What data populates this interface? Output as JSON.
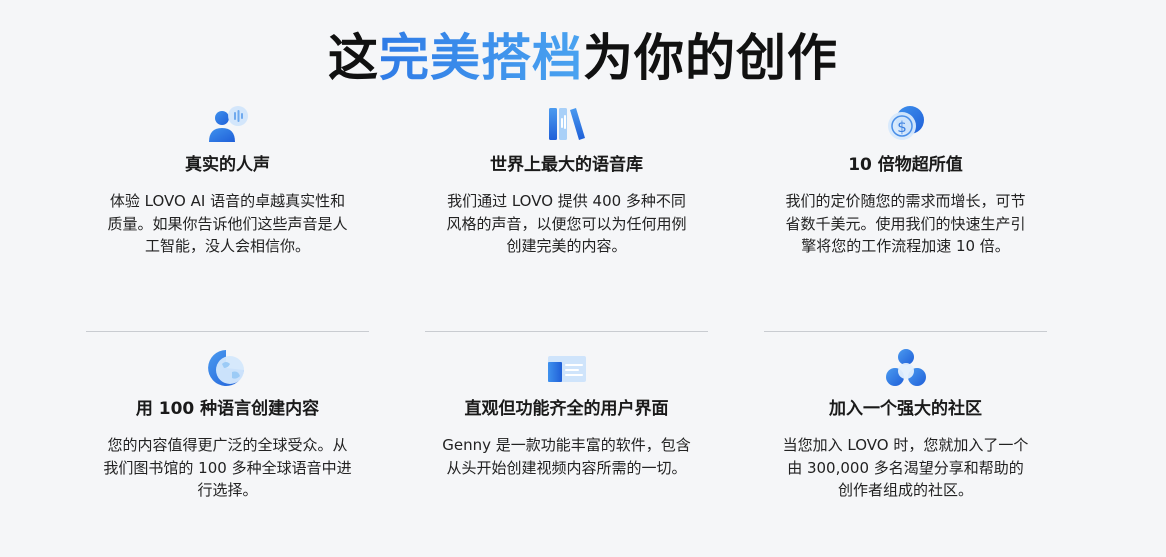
{
  "headline": {
    "part1": "这",
    "accent": "完美搭档",
    "part2": "为你的创作"
  },
  "features": [
    {
      "icon": "voice-person-icon",
      "title": "真实的人声",
      "desc": "体验 LOVO AI 语音的卓越真实性和质量。如果你告诉他们这些声音是人工智能，没人会相信你。"
    },
    {
      "icon": "library-books-icon",
      "title": "世界上最大的语音库",
      "desc": "我们通过 LOVO 提供 400 多种不同风格的声音，以便您可以为任何用例创建完美的内容。"
    },
    {
      "icon": "coin-dollar-icon",
      "title": "10 倍物超所值",
      "desc": "我们的定价随您的需求而增长，可节省数千美元。使用我们的快速生产引擎将您的工作流程加速 10 倍。"
    },
    {
      "icon": "globe-icon",
      "title": "用 100 种语言创建内容",
      "desc": "您的内容值得更广泛的全球受众。从我们图书馆的 100 多种全球语音中进行选择。"
    },
    {
      "icon": "editor-window-icon",
      "title": "直观但功能齐全的用户界面",
      "desc": "Genny 是一款功能丰富的软件，包含从头开始创建视频内容所需的一切。"
    },
    {
      "icon": "community-icon",
      "title": "加入一个强大的社区",
      "desc": "当您加入 LOVO 时，您就加入了一个由 300,000 多名渴望分享和帮助的创作者组成的社区。"
    }
  ],
  "colors": {
    "accent": "#2f7be6",
    "accent_light": "#8cc4f7",
    "background": "#f5f6f8"
  }
}
